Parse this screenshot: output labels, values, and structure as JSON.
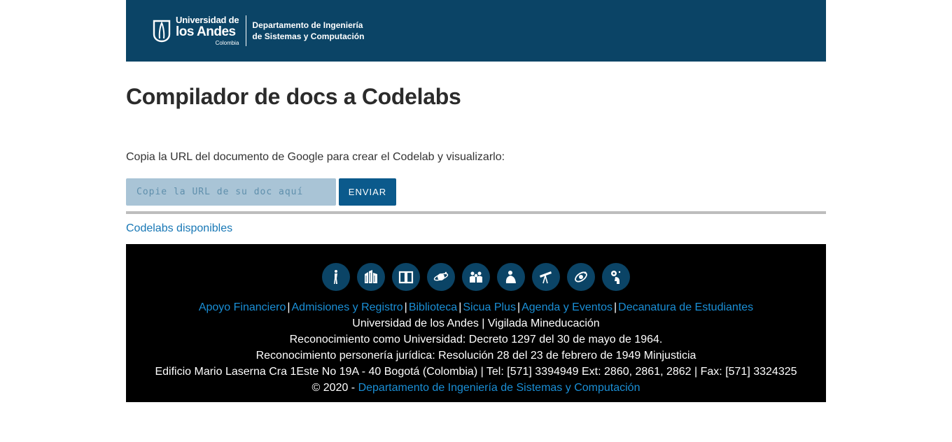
{
  "header": {
    "logo": {
      "line1": "Universidad de",
      "line2": "los Andes",
      "line3": "Colombia",
      "dept_line1": "Departamento de Ingeniería",
      "dept_line2": "de Sistemas y Computación"
    },
    "background": "#0b4466"
  },
  "main": {
    "title": "Compilador de docs a Codelabs",
    "instructions": "Copia la URL del documento de Google para crear el Codelab y visualizarlo:",
    "url_input": {
      "value": "",
      "placeholder": "Copie la URL de su doc aquí"
    },
    "send_label": "ENVIAR",
    "codelabs_link": "Codelabs disponibles"
  },
  "footer": {
    "icons": [
      "person-icon",
      "buildings-icon",
      "book-icon",
      "planet-icon",
      "group-icon",
      "student-icon",
      "telescope-icon",
      "orbit-icon",
      "thinking-icon"
    ],
    "links": [
      "Apoyo Financiero",
      "Admisiones y Registro",
      "Biblioteca",
      "Sicua Plus",
      "Agenda y Eventos",
      "Decanatura de Estudiantes"
    ],
    "line1": "Universidad de los Andes | Vigilada Mineducación",
    "line2": "Reconocimiento como Universidad: Decreto 1297 del 30 de mayo de 1964.",
    "line3": "Reconocimiento personería jurídica: Resolución 28 del 23 de febrero de 1949 Minjusticia",
    "line4": "Edificio Mario Laserna Cra 1Este No 19A - 40 Bogotá (Colombia) | Tel: [571] 3394949 Ext: 2860, 2861, 2862 | Fax: [571] 3324325",
    "copyright_prefix": "© 2020 - ",
    "copyright_link": "Departamento de Ingeniería de Sistemas y Computación"
  },
  "colors": {
    "header": "#0b4466",
    "button": "#0b5a8c",
    "input": "#a9c4d6",
    "link": "#1777b5",
    "footer": "#000000"
  }
}
